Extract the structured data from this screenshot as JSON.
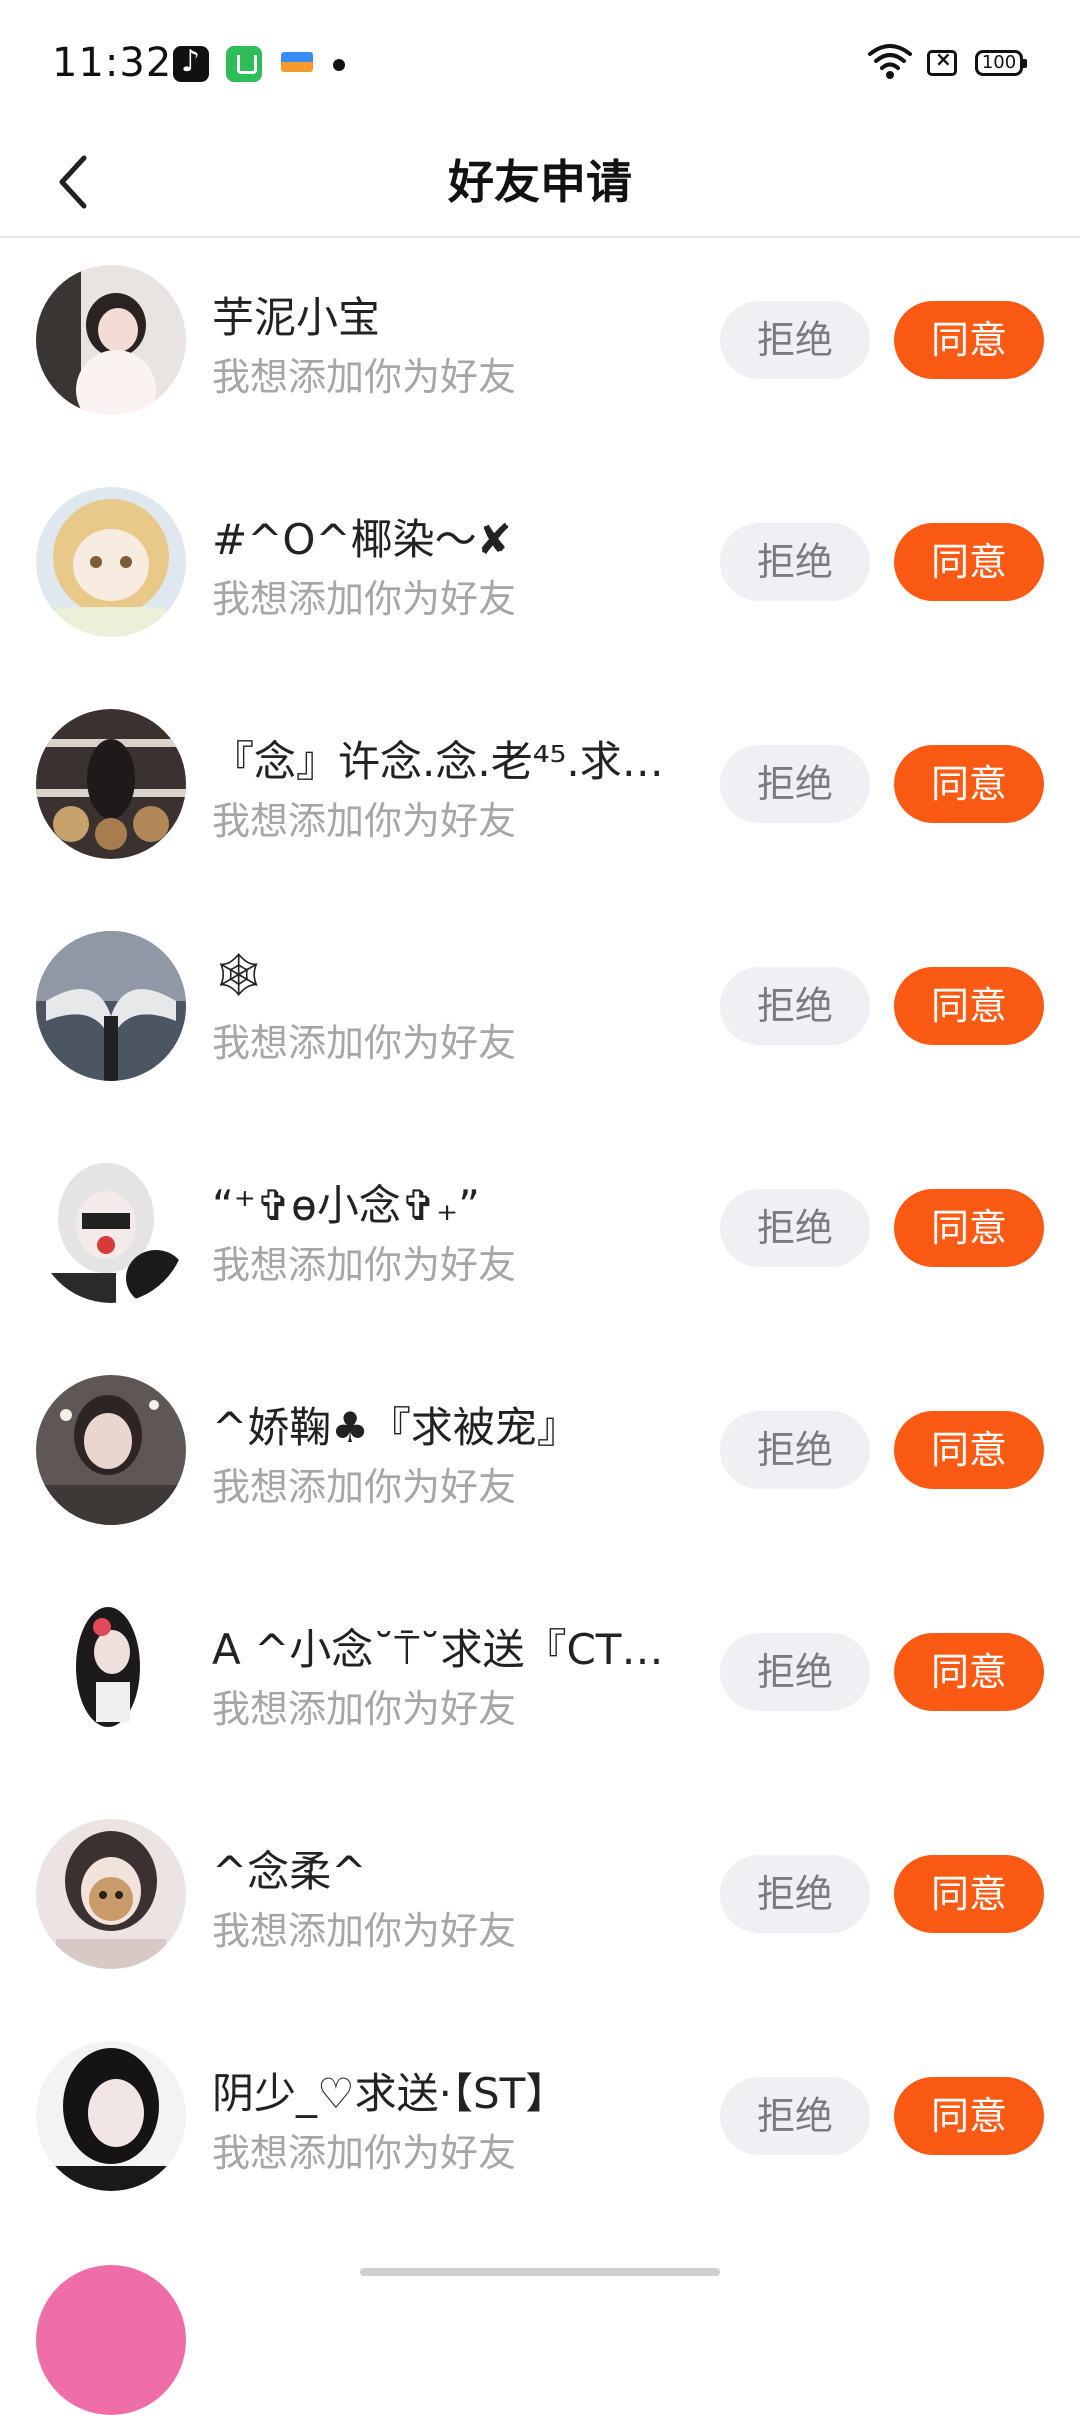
{
  "status_bar": {
    "time": "11:32",
    "battery": "100",
    "apps": [
      "tiktok-icon",
      "green-app-icon",
      "wallet-icon"
    ]
  },
  "header": {
    "title": "好友申请",
    "back_icon": "chevron-left-icon"
  },
  "colors": {
    "accept": "#fb5a14",
    "reject_bg": "#eef0f4",
    "message_text": "#a6a6a6"
  },
  "requests": [
    {
      "nickname": "芋泥小宝",
      "message": "我想添加你为好友",
      "reject_label": "拒绝",
      "accept_label": "同意"
    },
    {
      "nickname": "#^O^椰染～✘",
      "message": "我想添加你为好友",
      "reject_label": "拒绝",
      "accept_label": "同意"
    },
    {
      "nickname": "『念』许念.念.老⁴⁵.求…",
      "message": "我想添加你为好友",
      "reject_label": "拒绝",
      "accept_label": "同意"
    },
    {
      "nickname": "🕸",
      "message": "我想添加你为好友",
      "reject_label": "拒绝",
      "accept_label": "同意"
    },
    {
      "nickname": "“⁺✞ɵ小念✞₊”",
      "message": "我想添加你为好友",
      "reject_label": "拒绝",
      "accept_label": "同意"
    },
    {
      "nickname": "^娇鞠♣『求被宠』",
      "message": "我想添加你为好友",
      "reject_label": "拒绝",
      "accept_label": "同意"
    },
    {
      "nickname": "A ^小念˘⍑˘求送『CT…",
      "message": "我想添加你为好友",
      "reject_label": "拒绝",
      "accept_label": "同意"
    },
    {
      "nickname": "^念柔^",
      "message": "我想添加你为好友",
      "reject_label": "拒绝",
      "accept_label": "同意"
    },
    {
      "nickname": "阴少_♡求送·【ST】",
      "message": "我想添加你为好友",
      "reject_label": "拒绝",
      "accept_label": "同意"
    }
  ]
}
